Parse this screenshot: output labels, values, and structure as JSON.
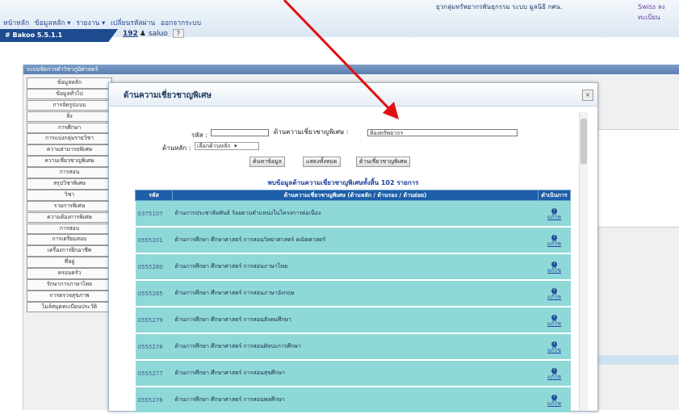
{
  "top_menu": [
    "หน้าหลัก",
    "ข้อมูลหลัก ▾",
    "รายงาน ▾",
    "เปลี่ยนรหัสผ่าน",
    "ออกจากระบบ"
  ],
  "top_right_text": "ยุวกลุ่มทรัพยากรพันธุกรรม  ระบบ มูลนิธิ กศน.",
  "top_right_extra": "Swiss ลงทะเบียน",
  "brand_label": "# Bakoo 5.5.1.1",
  "user_bar": {
    "user_id": "192",
    "username": "saluo",
    "help_button": "?"
  },
  "frame_title": "ระบบจัดการคำวิชาภูมิศาสตร์",
  "sidebar_items": [
    "ข้อมูลหลัก",
    "ข้อมูลทั่วไป",
    "การจัดรูปแบบ",
    "สิ่ง",
    "การศึกษา",
    "การแบ่งกลุ่มรายวิชา",
    "ความสามารถพิเศษ",
    "ความเชี่ยวชาญพิเศษ",
    "การสอน",
    "สรุปวิชาพิเศษ",
    "วิชา",
    "รายการพิเศษ",
    "ความต้องการพิเศษ",
    "การสอบ",
    "การเตรียมสอบ",
    "เครื่องการฝึกอาชีพ",
    "ที่อยู่",
    "ครอบครัว",
    "รักษาการภาษาไทย",
    "การตรวจสุขภาพ",
    "ไมล์สมุดทะเบียนประวัติ"
  ],
  "dialog": {
    "title": "ด้านความเชี่ยวชาญพิเศษ",
    "close_icon": "×",
    "code_label": "รหัส :",
    "name_label": "ด้านความเชี่ยวชาญพิเศษ :",
    "name_value": "ห้องทรัพยากร",
    "category_label": "ด้านหลัก :",
    "category_value": "เลือกด้านหลัก",
    "buttons": [
      "ค้นหาข้อมูล",
      "แสดงทั้งหมด",
      "ด้านเชี่ยวชาญพิเศษ"
    ],
    "result_count": "พบข้อมูลด้านความเชี่ยวชาญพิเศษทั้งสิ้น 102 รายการ",
    "table_headers": [
      "รหัส",
      "ด้านความเชี่ยวชาญพิเศษ (ด้านหลัก / ด้านรอง / ด้านย่อย)",
      "ดำเนินการ"
    ],
    "rows": [
      {
        "code": "0375107",
        "name": "ด้านการประชาสัมพันธ์ ร้อยตามตำแหน่งในโครงการต่อเนื่อง"
      },
      {
        "code": "0555201",
        "name": "ด้านการศึกษา ศึกษาศาสตร์ การสอนวิทยาศาสตร์ คณิตศาสตร์"
      },
      {
        "code": "0555280",
        "name": "ด้านการศึกษา ศึกษาศาสตร์ การสอนภาษาไทย"
      },
      {
        "code": "0555285",
        "name": "ด้านการศึกษา ศึกษาศาสตร์ การสอนภาษาอังกฤษ"
      },
      {
        "code": "0555279",
        "name": "ด้านการศึกษา ศึกษาศาสตร์ การสอนสังคมศึกษา"
      },
      {
        "code": "0555278",
        "name": "ด้านการศึกษา ศึกษาศาสตร์ การสอนศิลปะการศึกษา"
      },
      {
        "code": "0555277",
        "name": "ด้านการศึกษา ศึกษาศาสตร์ การสอนสุขศึกษา"
      },
      {
        "code": "0555276",
        "name": "ด้านการศึกษา ศึกษาศาสตร์ การสอนพลศึกษา"
      }
    ],
    "action_label": "แก้ไข"
  },
  "annotation_arrow_color": "#e01010"
}
